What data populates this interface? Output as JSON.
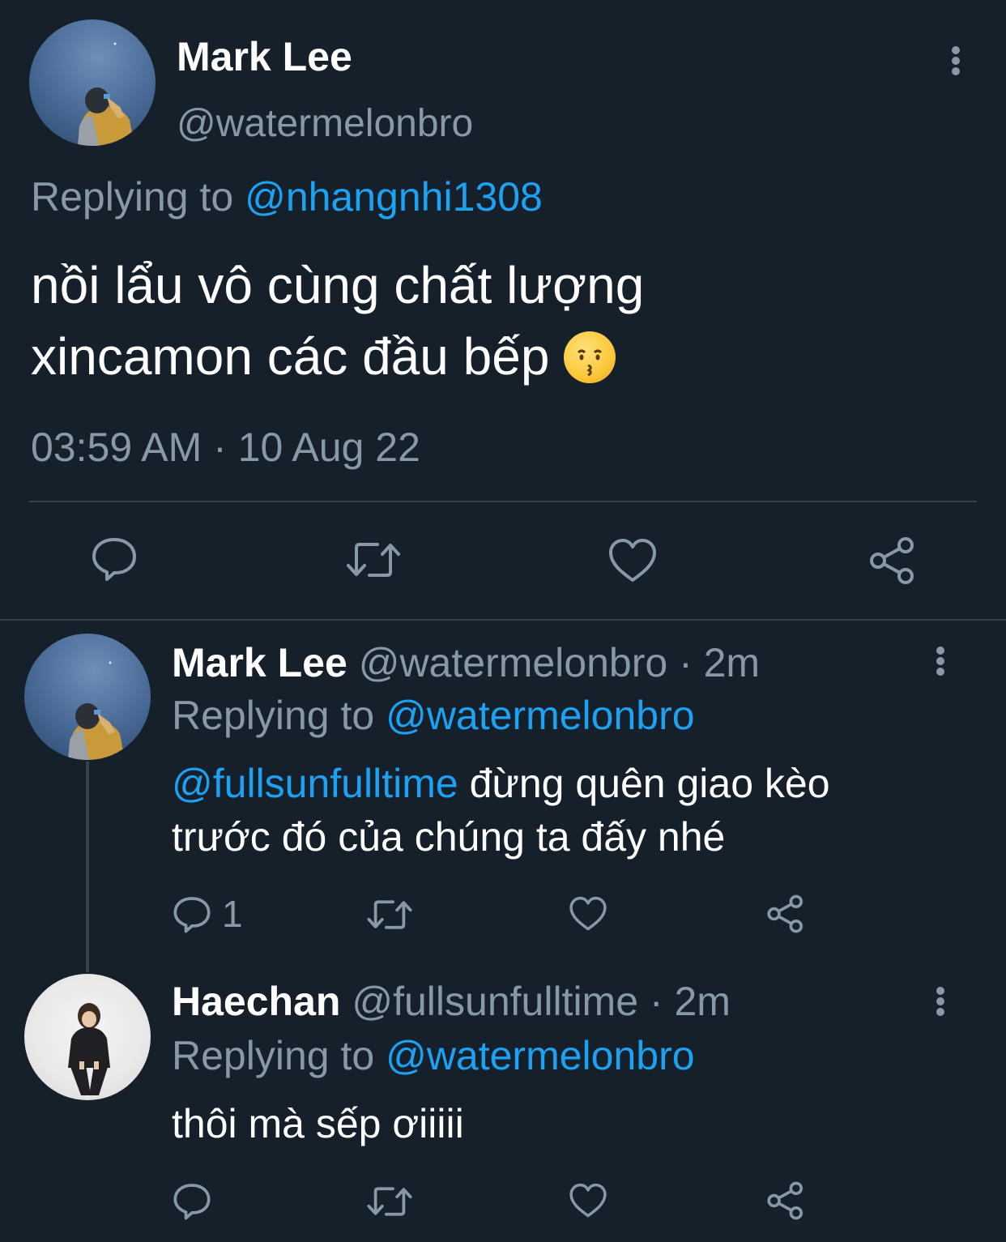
{
  "main_tweet": {
    "author_name": "Mark Lee",
    "author_handle": "@watermelonbro",
    "replying_prefix": "Replying to",
    "replying_handle": "@nhangnhi1308",
    "text_line1": "nồi lẩu vô cùng chất lượng",
    "text_line2": "xincamon các đầu bếp",
    "emoji": "kissing-face",
    "timestamp": "03:59 AM · 10 Aug 22"
  },
  "reply_1": {
    "author_name": "Mark Lee",
    "author_handle": "@watermelonbro",
    "time": "· 2m",
    "replying_prefix": "Replying to",
    "replying_handle": "@watermelonbro",
    "mention": "@fullsunfulltime",
    "text_rest": " đừng quên giao kèo",
    "text_line2": "trước đó của chúng ta đấy nhé",
    "reply_count": "1"
  },
  "reply_2": {
    "author_name": "Haechan",
    "author_handle": "@fullsunfulltime",
    "time": "· 2m",
    "replying_prefix": "Replying to",
    "replying_handle": "@watermelonbro",
    "text": "thôi mà sếp ơiiiii"
  },
  "colors": {
    "background": "#15202b",
    "muted": "#8899a6",
    "link": "#1da1f2",
    "divider": "#38444d"
  }
}
